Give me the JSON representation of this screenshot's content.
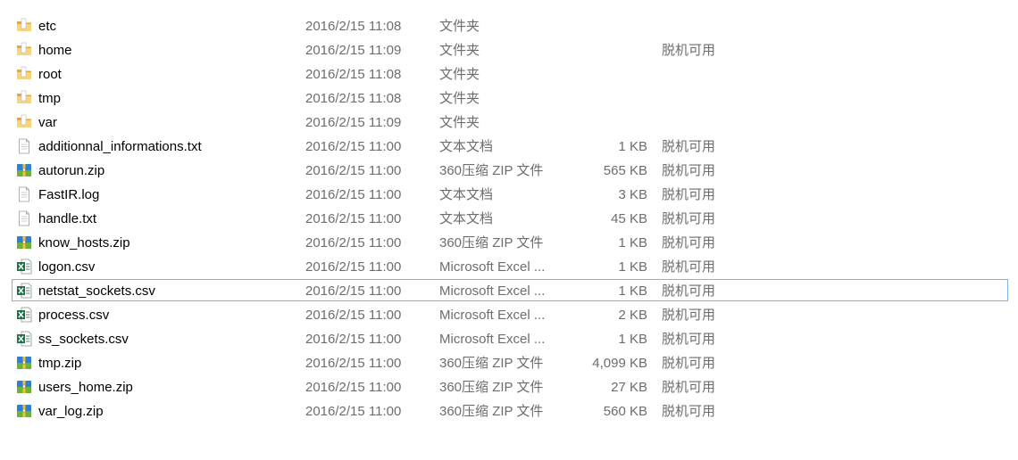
{
  "files": [
    {
      "name": "etc",
      "date": "2016/2/15 11:08",
      "type": "文件夹",
      "size": "",
      "status": "",
      "icon": "folder-icon"
    },
    {
      "name": "home",
      "date": "2016/2/15 11:09",
      "type": "文件夹",
      "size": "",
      "status": "脱机可用",
      "icon": "folder-icon"
    },
    {
      "name": "root",
      "date": "2016/2/15 11:08",
      "type": "文件夹",
      "size": "",
      "status": "",
      "icon": "folder-icon"
    },
    {
      "name": "tmp",
      "date": "2016/2/15 11:08",
      "type": "文件夹",
      "size": "",
      "status": "",
      "icon": "folder-icon"
    },
    {
      "name": "var",
      "date": "2016/2/15 11:09",
      "type": "文件夹",
      "size": "",
      "status": "",
      "icon": "folder-icon"
    },
    {
      "name": "additionnal_informations.txt",
      "date": "2016/2/15 11:00",
      "type": "文本文档",
      "size": "1 KB",
      "status": "脱机可用",
      "icon": "text-file-icon"
    },
    {
      "name": "autorun.zip",
      "date": "2016/2/15 11:00",
      "type": "360压缩 ZIP 文件",
      "size": "565 KB",
      "status": "脱机可用",
      "icon": "zip-archive-icon"
    },
    {
      "name": "FastIR.log",
      "date": "2016/2/15 11:00",
      "type": "文本文档",
      "size": "3 KB",
      "status": "脱机可用",
      "icon": "text-file-icon"
    },
    {
      "name": "handle.txt",
      "date": "2016/2/15 11:00",
      "type": "文本文档",
      "size": "45 KB",
      "status": "脱机可用",
      "icon": "text-file-icon"
    },
    {
      "name": "know_hosts.zip",
      "date": "2016/2/15 11:00",
      "type": "360压缩 ZIP 文件",
      "size": "1 KB",
      "status": "脱机可用",
      "icon": "zip-archive-icon"
    },
    {
      "name": "logon.csv",
      "date": "2016/2/15 11:00",
      "type": "Microsoft Excel ...",
      "size": "1 KB",
      "status": "脱机可用",
      "icon": "excel-csv-icon"
    },
    {
      "name": "netstat_sockets.csv",
      "date": "2016/2/15 11:00",
      "type": "Microsoft Excel ...",
      "size": "1 KB",
      "status": "脱机可用",
      "icon": "excel-csv-icon",
      "selected": true
    },
    {
      "name": "process.csv",
      "date": "2016/2/15 11:00",
      "type": "Microsoft Excel ...",
      "size": "2 KB",
      "status": "脱机可用",
      "icon": "excel-csv-icon"
    },
    {
      "name": "ss_sockets.csv",
      "date": "2016/2/15 11:00",
      "type": "Microsoft Excel ...",
      "size": "1 KB",
      "status": "脱机可用",
      "icon": "excel-csv-icon"
    },
    {
      "name": "tmp.zip",
      "date": "2016/2/15 11:00",
      "type": "360压缩 ZIP 文件",
      "size": "4,099 KB",
      "status": "脱机可用",
      "icon": "zip-archive-icon"
    },
    {
      "name": "users_home.zip",
      "date": "2016/2/15 11:00",
      "type": "360压缩 ZIP 文件",
      "size": "27 KB",
      "status": "脱机可用",
      "icon": "zip-archive-icon"
    },
    {
      "name": "var_log.zip",
      "date": "2016/2/15 11:00",
      "type": "360压缩 ZIP 文件",
      "size": "560 KB",
      "status": "脱机可用",
      "icon": "zip-archive-icon"
    }
  ],
  "colors": {
    "selection_border": "#7eb4ea",
    "secondary_text": "#6d6d6d",
    "folder": "#f1c660",
    "excel_green": "#1e7145",
    "zip_blue": "#2f7fd6"
  }
}
